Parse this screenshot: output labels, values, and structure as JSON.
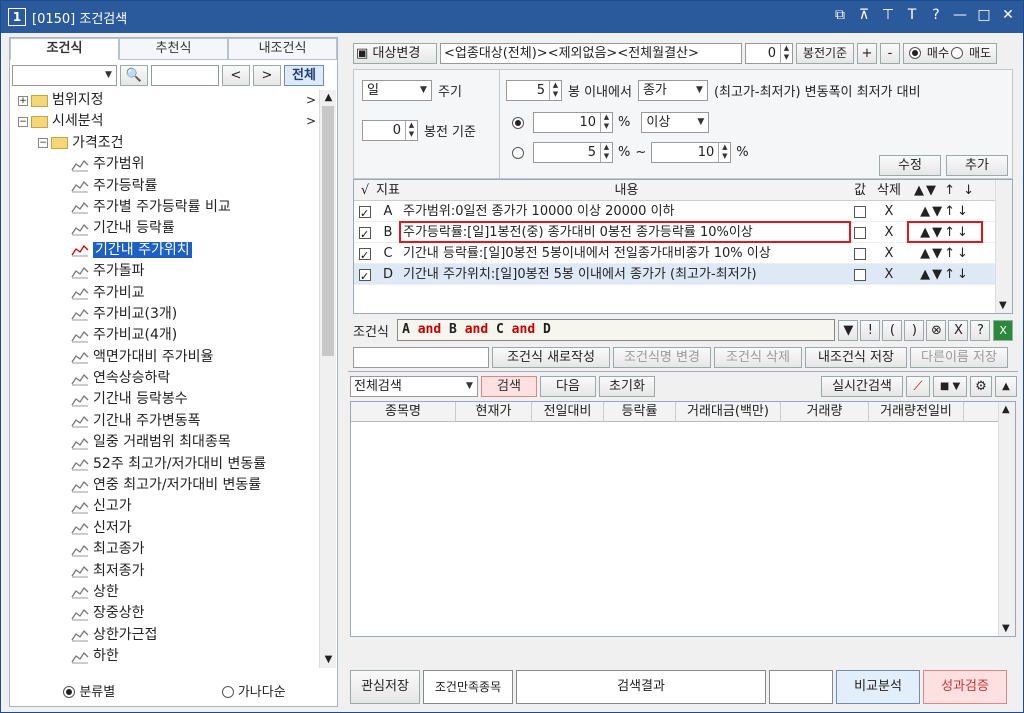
{
  "window": {
    "num": "1",
    "title": "[0150] 조건검색",
    "icons": [
      "window-icon",
      "pin-icon",
      "pin2-icon",
      "text-icon",
      "help-icon",
      "minimize-icon",
      "maximize-icon",
      "close-icon"
    ],
    "icon_glyphs": [
      "⧉",
      "⊼",
      "⊤",
      "T",
      "?",
      "—",
      "□",
      "✕"
    ]
  },
  "left": {
    "tabs": [
      "조건식",
      "추천식",
      "내조건식"
    ],
    "all_btn": "전체",
    "nav_prev": "<",
    "nav_next": ">",
    "tree": [
      {
        "label": "범위지정",
        "level": 0,
        "type": "folder",
        "exp": "+",
        "chev": ">"
      },
      {
        "label": "시세분석",
        "level": 0,
        "type": "folder",
        "exp": "−",
        "chev": ">"
      },
      {
        "label": "가격조건",
        "level": 1,
        "type": "folder",
        "exp": "−"
      },
      {
        "label": "주가범위",
        "level": 2,
        "type": "chart"
      },
      {
        "label": "주가등락률",
        "level": 2,
        "type": "chart"
      },
      {
        "label": "주가별 주가등락률 비교",
        "level": 2,
        "type": "chart"
      },
      {
        "label": "기간내 등락률",
        "level": 2,
        "type": "chart"
      },
      {
        "label": "기간내 주가위치",
        "level": 2,
        "type": "chart",
        "selected": true
      },
      {
        "label": "주가돌파",
        "level": 2,
        "type": "chart"
      },
      {
        "label": "주가비교",
        "level": 2,
        "type": "chart"
      },
      {
        "label": "주가비교(3개)",
        "level": 2,
        "type": "chart"
      },
      {
        "label": "주가비교(4개)",
        "level": 2,
        "type": "chart"
      },
      {
        "label": "액면가대비 주가비율",
        "level": 2,
        "type": "chart"
      },
      {
        "label": "연속상승하락",
        "level": 2,
        "type": "chart"
      },
      {
        "label": "기간내 등락봉수",
        "level": 2,
        "type": "chart"
      },
      {
        "label": "기간내 주가변동폭",
        "level": 2,
        "type": "chart"
      },
      {
        "label": "일중 거래범위 최대종목",
        "level": 2,
        "type": "chart"
      },
      {
        "label": "52주 최고가/저가대비 변동률",
        "level": 2,
        "type": "chart"
      },
      {
        "label": "연중 최고가/저가대비 변동률",
        "level": 2,
        "type": "chart"
      },
      {
        "label": "신고가",
        "level": 2,
        "type": "chart"
      },
      {
        "label": "신저가",
        "level": 2,
        "type": "chart"
      },
      {
        "label": "최고종가",
        "level": 2,
        "type": "chart"
      },
      {
        "label": "최저종가",
        "level": 2,
        "type": "chart"
      },
      {
        "label": "상한",
        "level": 2,
        "type": "chart"
      },
      {
        "label": "장중상한",
        "level": 2,
        "type": "chart"
      },
      {
        "label": "상한가근접",
        "level": 2,
        "type": "chart"
      },
      {
        "label": "하한",
        "level": 2,
        "type": "chart"
      }
    ],
    "radio1": "분류별",
    "radio2": "가나다순"
  },
  "right": {
    "target_btn": "대상변경",
    "target_text": "<업종대상(전체)><제외없음><전체월결산>",
    "bars_before": "0",
    "bars_before_label": "봉전기준",
    "plus": "+",
    "minus": "-",
    "buy": "매수",
    "sell": "매도",
    "period_value": "일",
    "period_label": "주기",
    "bars_value": "5",
    "bars_text": "봉 이내에서",
    "price_type": "종가",
    "range_text": "(최고가-최저가) 변동폭이 최저가 대비",
    "base_value": "0",
    "base_label": "봉전 기준",
    "pct1_value": "10",
    "pct_sign": "%",
    "cond_op": "이상",
    "pct2_from": "5",
    "tilde": "~",
    "pct2_to": "10",
    "edit_btn": "수정",
    "add_btn": "추가",
    "table_headers": [
      "√",
      "지표",
      "내용",
      "값",
      "삭제",
      "▲▼ ↑ ↓"
    ],
    "rows": [
      {
        "id": "A",
        "text": "주가범위:0일전 종가가 10000 이상 20000 이하",
        "del": "X",
        "ord": "▲▼↑↓"
      },
      {
        "id": "B",
        "text": "주가등락률:[일]1봉전(중) 종가대비 0봉전 종가등락률 10%이상",
        "del": "X",
        "ord": "▲▼↑↓"
      },
      {
        "id": "C",
        "text": "기간내 등락률:[일]0봉전 5봉이내에서 전일종가대비종가 10% 이상",
        "del": "X",
        "ord": "▲▼↑↓"
      },
      {
        "id": "D",
        "text": "기간내 주가위치:[일]0봉전 5봉 이내에서 종가가 (최고가-최저가)",
        "del": "X",
        "ord": "▲▼↑↓"
      }
    ],
    "cond_label": "조건식",
    "cond_expr": "A and B and C and D",
    "cond_tools": [
      "▼",
      "!",
      "(",
      ")",
      "⊗",
      "X",
      "?"
    ],
    "new_btn": "조건식 새로작성",
    "rename_btn": "조건식명 변경",
    "delete_btn": "조건식 삭제",
    "save_btn": "내조건식 저장",
    "saveas_btn": "다른이름 저장",
    "search_scope": "전체검색",
    "search_btn": "검색",
    "next_btn": "다음",
    "reset_btn": "초기화",
    "realtime_btn": "실시간검색",
    "grid_headers": [
      "종목명",
      "현재가",
      "전일대비",
      "등락률",
      "거래대금(백만)",
      "거래량",
      "거래량전일비"
    ],
    "watch_save": "관심저장",
    "match_label": "조건만족종목",
    "result_label": "검색결과",
    "compare_btn": "비교분석",
    "verify_btn": "성과검증"
  }
}
